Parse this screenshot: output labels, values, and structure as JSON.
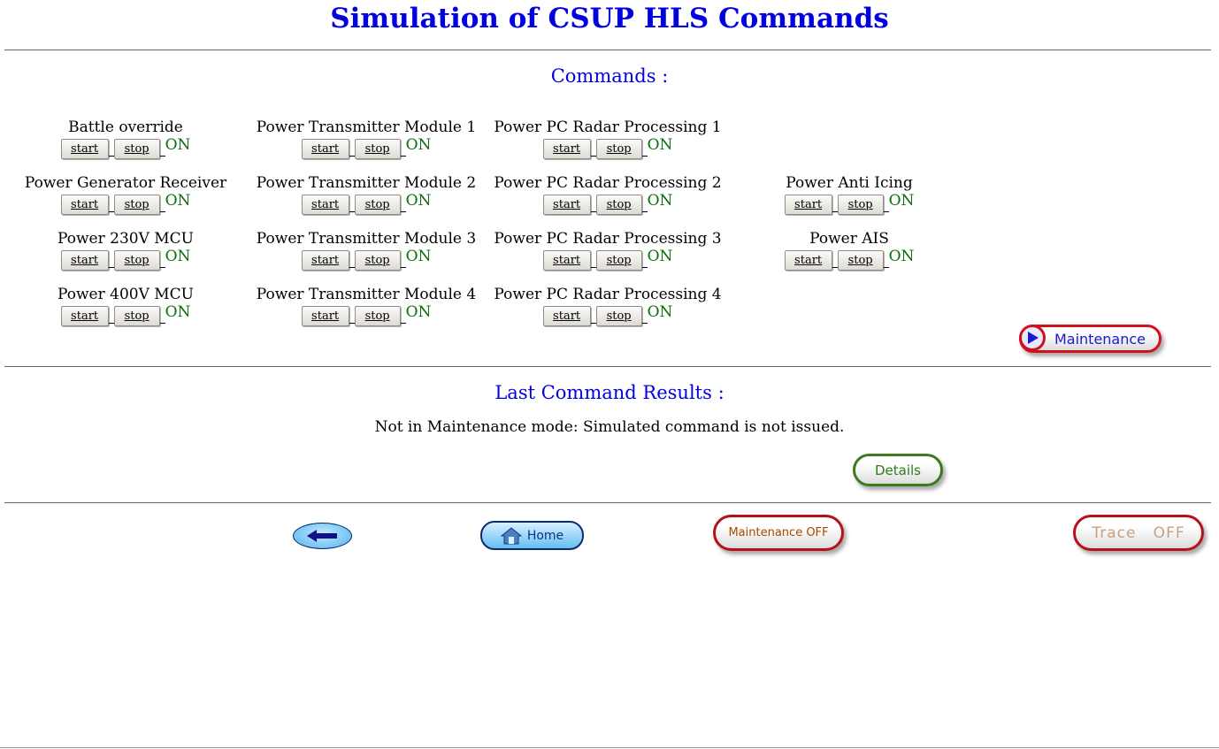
{
  "page": {
    "title": "Simulation of CSUP HLS Commands"
  },
  "commands_section": {
    "title": "Commands :",
    "start_label": "start",
    "stop_label": "stop",
    "columns": [
      [
        {
          "label": "Battle override",
          "status": "ON"
        },
        {
          "label": "Power Generator Receiver",
          "status": "ON"
        },
        {
          "label": "Power 230V MCU",
          "status": "ON"
        },
        {
          "label": "Power 400V MCU",
          "status": "ON"
        }
      ],
      [
        {
          "label": "Power Transmitter Module 1",
          "status": "ON"
        },
        {
          "label": "Power Transmitter Module 2",
          "status": "ON"
        },
        {
          "label": "Power Transmitter Module 3",
          "status": "ON"
        },
        {
          "label": "Power Transmitter Module 4",
          "status": "ON"
        }
      ],
      [
        {
          "label": "Power PC Radar Processing 1",
          "status": "ON"
        },
        {
          "label": "Power PC Radar Processing 2",
          "status": "ON"
        },
        {
          "label": "Power PC Radar Processing 3",
          "status": "ON"
        },
        {
          "label": "Power PC Radar Processing 4",
          "status": "ON"
        }
      ],
      [
        null,
        {
          "label": "Power Anti Icing",
          "status": "ON"
        },
        {
          "label": "Power AIS",
          "status": "ON"
        },
        null
      ]
    ],
    "maintenance_button_label": "Maintenance"
  },
  "results_section": {
    "title": "Last Command Results :",
    "message": "Not in Maintenance mode: Simulated command is not issued.",
    "details_button_label": "Details"
  },
  "footer": {
    "home_button_label": "Home",
    "maintenance_off_label": "Maintenance OFF",
    "trace_off_label": "Trace   OFF"
  },
  "colors": {
    "title_blue": "#0000e0",
    "status_green": "#0a6e0a",
    "maintenance_red": "#d0101a",
    "details_green": "#3c7a1c"
  },
  "icons": [
    "play-icon",
    "back-arrow-icon",
    "home-icon"
  ]
}
